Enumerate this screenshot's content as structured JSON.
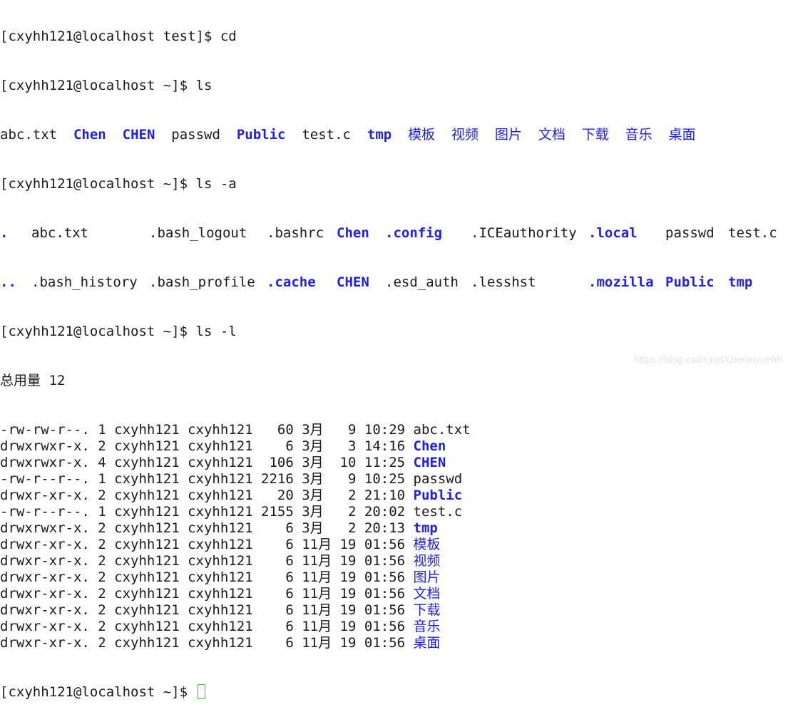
{
  "terminal": {
    "cut_line": "[cxyhh121@localhost test]$ cd",
    "prompt": "[cxyhh121@localhost ~]$ ",
    "cmd_ls": "ls",
    "cmd_ls_a": "ls -a",
    "cmd_ls_l": "ls -l",
    "ls_output": [
      {
        "name": "abc.txt",
        "dir": false
      },
      {
        "name": "Chen",
        "dir": true
      },
      {
        "name": "CHEN",
        "dir": true
      },
      {
        "name": "passwd",
        "dir": false
      },
      {
        "name": "Public",
        "dir": true
      },
      {
        "name": "test.c",
        "dir": false
      },
      {
        "name": "tmp",
        "dir": true
      },
      {
        "name": "模板",
        "dir": true
      },
      {
        "name": "视频",
        "dir": true
      },
      {
        "name": "图片",
        "dir": true
      },
      {
        "name": "文档",
        "dir": true
      },
      {
        "name": "下载",
        "dir": true
      },
      {
        "name": "音乐",
        "dir": true
      },
      {
        "name": "桌面",
        "dir": true
      }
    ],
    "ls_a_rows": [
      [
        {
          "name": ".",
          "dir": true
        },
        {
          "name": "abc.txt",
          "dir": false
        },
        {
          "name": ".bash_logout",
          "dir": false
        },
        {
          "name": ".bashrc",
          "dir": false
        },
        {
          "name": "Chen",
          "dir": true
        },
        {
          "name": ".config",
          "dir": true
        },
        {
          "name": ".ICEauthority",
          "dir": false
        },
        {
          "name": ".local",
          "dir": true
        },
        {
          "name": "passwd",
          "dir": false
        },
        {
          "name": "test.c",
          "dir": false
        }
      ],
      [
        {
          "name": "..",
          "dir": true
        },
        {
          "name": ".bash_history",
          "dir": false
        },
        {
          "name": ".bash_profile",
          "dir": false
        },
        {
          "name": ".cache",
          "dir": true
        },
        {
          "name": "CHEN",
          "dir": true
        },
        {
          "name": ".esd_auth",
          "dir": false
        },
        {
          "name": ".lesshst",
          "dir": false
        },
        {
          "name": ".mozilla",
          "dir": true
        },
        {
          "name": "Public",
          "dir": true
        },
        {
          "name": "tmp",
          "dir": true
        }
      ]
    ],
    "total_line": "总用量 12",
    "ls_l_rows": [
      {
        "prefix": "-rw-rw-r--. 1 cxyhh121 cxyhh121   60 3月   9 10:29 ",
        "name": "abc.txt",
        "dir": false
      },
      {
        "prefix": "drwxrwxr-x. 2 cxyhh121 cxyhh121    6 3月   3 14:16 ",
        "name": "Chen",
        "dir": true
      },
      {
        "prefix": "drwxrwxr-x. 4 cxyhh121 cxyhh121  106 3月  10 11:25 ",
        "name": "CHEN",
        "dir": true
      },
      {
        "prefix": "-rw-r--r--. 1 cxyhh121 cxyhh121 2216 3月   9 10:25 ",
        "name": "passwd",
        "dir": false
      },
      {
        "prefix": "drwxr-xr-x. 2 cxyhh121 cxyhh121   20 3月   2 21:10 ",
        "name": "Public",
        "dir": true
      },
      {
        "prefix": "-rw-r--r--. 1 cxyhh121 cxyhh121 2155 3月   2 20:02 ",
        "name": "test.c",
        "dir": false
      },
      {
        "prefix": "drwxrwxr-x. 2 cxyhh121 cxyhh121    6 3月   2 20:13 ",
        "name": "tmp",
        "dir": true
      },
      {
        "prefix": "drwxr-xr-x. 2 cxyhh121 cxyhh121    6 11月 19 01:56 ",
        "name": "模板",
        "dir": true
      },
      {
        "prefix": "drwxr-xr-x. 2 cxyhh121 cxyhh121    6 11月 19 01:56 ",
        "name": "视频",
        "dir": true
      },
      {
        "prefix": "drwxr-xr-x. 2 cxyhh121 cxyhh121    6 11月 19 01:56 ",
        "name": "图片",
        "dir": true
      },
      {
        "prefix": "drwxr-xr-x. 2 cxyhh121 cxyhh121    6 11月 19 01:56 ",
        "name": "文档",
        "dir": true
      },
      {
        "prefix": "drwxr-xr-x. 2 cxyhh121 cxyhh121    6 11月 19 01:56 ",
        "name": "下载",
        "dir": true
      },
      {
        "prefix": "drwxr-xr-x. 2 cxyhh121 cxyhh121    6 11月 19 01:56 ",
        "name": "音乐",
        "dir": true
      },
      {
        "prefix": "drwxr-xr-x. 2 cxyhh121 cxyhh121    6 11月 19 01:56 ",
        "name": "桌面",
        "dir": true
      }
    ]
  },
  "watermark": "https://blog.csdn.net/chenxiyuehh"
}
